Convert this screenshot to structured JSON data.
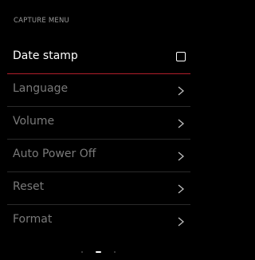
{
  "screen": {
    "title": "CAPTURE MENU"
  },
  "menu": {
    "items": [
      {
        "label": "Date stamp",
        "control": "checkbox",
        "checked": false,
        "selected": true
      },
      {
        "label": "Language",
        "control": "chevron-right-icon",
        "selected": false
      },
      {
        "label": "Volume",
        "control": "chevron-right-icon",
        "selected": false
      },
      {
        "label": "Auto Power Off",
        "control": "chevron-right-icon",
        "selected": false
      },
      {
        "label": "Reset",
        "control": "chevron-right-icon",
        "selected": false
      },
      {
        "label": "Format",
        "control": "chevron-right-icon",
        "selected": false
      }
    ]
  },
  "pager": {
    "page_count": 3,
    "current_page": 2
  },
  "colors": {
    "background": "#000000",
    "selected_text": "#ffffff",
    "unselected_text": "#7a7a7a",
    "title_text": "#9a9a9a",
    "selection_underline": "#b01e2a",
    "divider": "#2a2a2a"
  }
}
